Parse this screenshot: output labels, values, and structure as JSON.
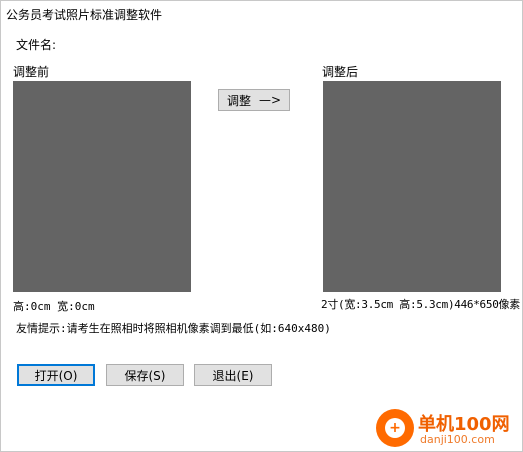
{
  "window": {
    "title": "公务员考试照片标准调整软件"
  },
  "labels": {
    "filename": "文件名:",
    "before": "调整前",
    "after": "调整后",
    "before_dims": "高:0cm  宽:0cm",
    "after_dims": "2寸(宽:3.5cm 高:5.3cm)446*650像素",
    "tip": "友情提示:请考生在照相时将照相机像素调到最低(如:640x480)"
  },
  "buttons": {
    "adjust": "调整",
    "adjust_arrow": "—>",
    "open": "打开(O)",
    "save": "保存(S)",
    "exit": "退出(E)"
  },
  "colors": {
    "preview": "#646464",
    "default_button_border": "#0078d7"
  },
  "watermark": {
    "brand": "单机100网",
    "url": "danji100.com"
  }
}
